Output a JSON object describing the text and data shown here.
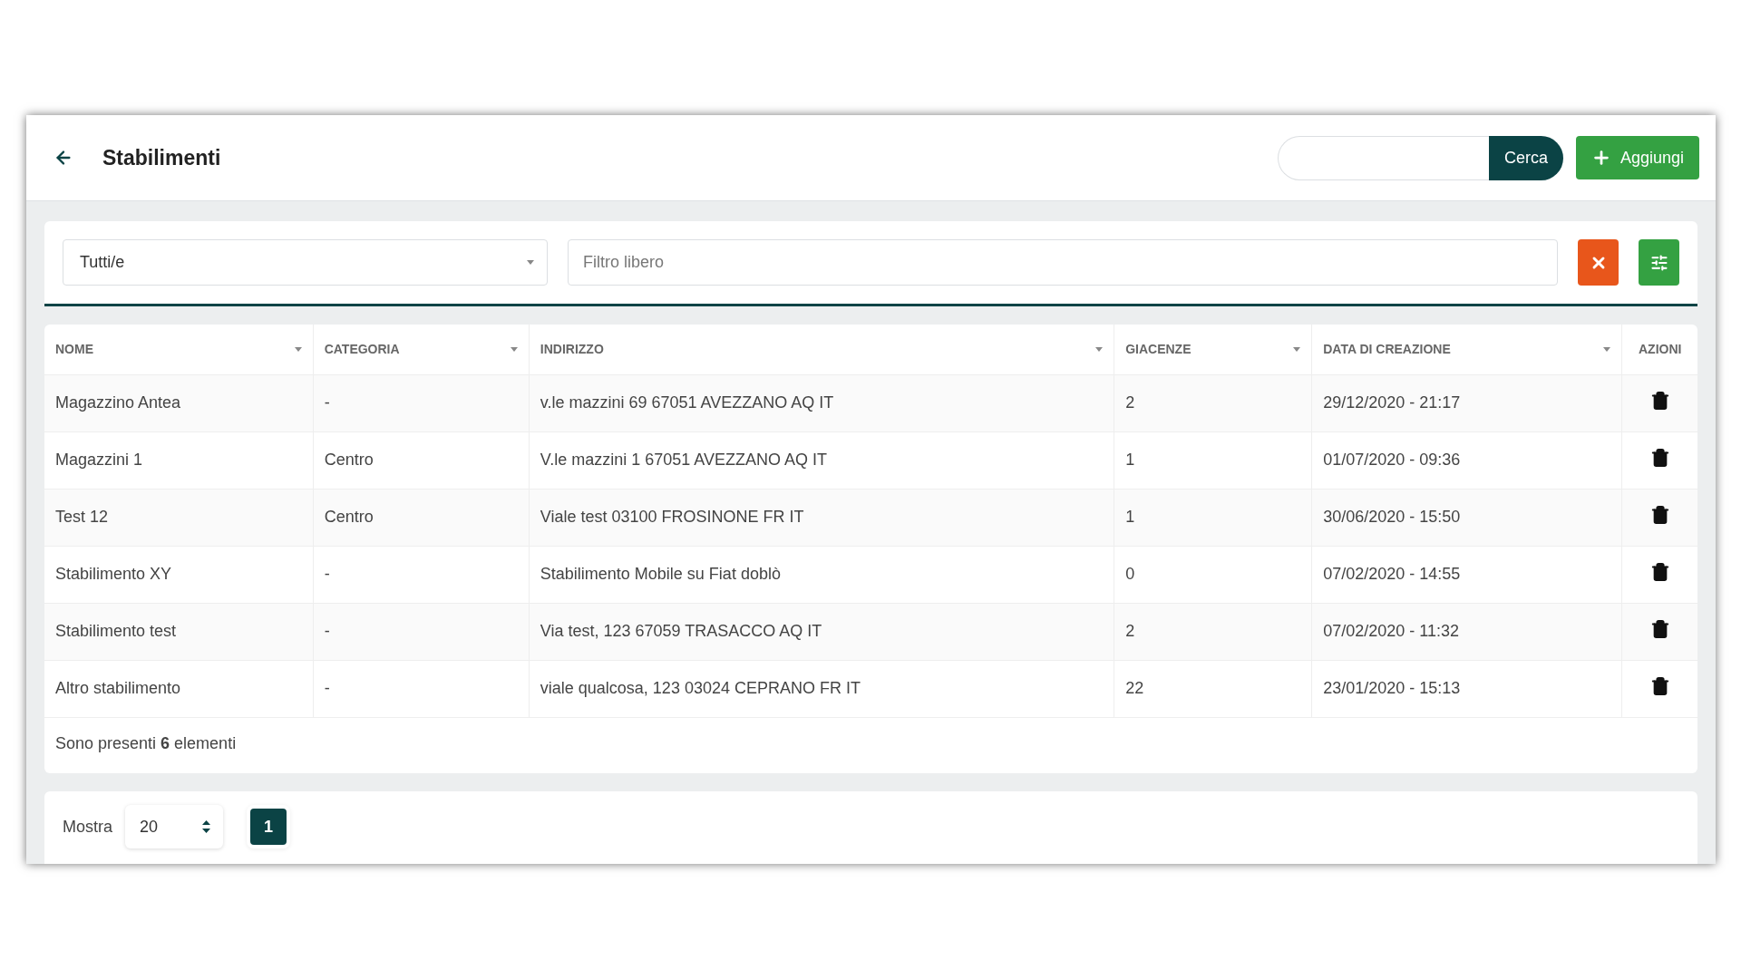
{
  "header": {
    "title": "Stabilimenti",
    "search": {
      "button": "Cerca"
    },
    "add_button": "Aggiungi"
  },
  "filters": {
    "category": "Tutti/e",
    "free_filter": {
      "placeholder": "Filtro libero"
    }
  },
  "table": {
    "columns": [
      {
        "label": "NOME",
        "sortable": true
      },
      {
        "label": "CATEGORIA",
        "sortable": true
      },
      {
        "label": "INDIRIZZO",
        "sortable": true
      },
      {
        "label": "GIACENZE",
        "sortable": true
      },
      {
        "label": "DATA DI CREAZIONE",
        "sortable": true
      },
      {
        "label": "AZIONI",
        "sortable": false
      }
    ],
    "rows": [
      {
        "cells": [
          "Magazzino Antea",
          "-",
          "v.le mazzini 69 67051 AVEZZANO AQ IT",
          "2",
          "29/12/2020 - 21:17"
        ]
      },
      {
        "cells": [
          "Magazzini 1",
          "Centro",
          "V.le mazzini 1 67051 AVEZZANO AQ IT",
          "1",
          "01/07/2020 - 09:36"
        ]
      },
      {
        "cells": [
          "Test 12",
          "Centro",
          "Viale test 03100 FROSINONE FR IT",
          "1",
          "30/06/2020 - 15:50"
        ]
      },
      {
        "cells": [
          "Stabilimento XY",
          "-",
          "Stabilimento Mobile su Fiat doblò",
          "0",
          "07/02/2020 - 14:55"
        ]
      },
      {
        "cells": [
          "Stabilimento test",
          "-",
          "Via test, 123 67059 TRASACCO AQ IT",
          "2",
          "07/02/2020 - 11:32"
        ]
      },
      {
        "cells": [
          "Altro stabilimento",
          "-",
          "viale qualcosa, 123 03024 CEPRANO FR IT",
          "22",
          "23/01/2020 - 15:13"
        ]
      }
    ],
    "summary": "Sono presenti **6** elementi"
  },
  "pagination": {
    "label": "Mostra",
    "page_size": "20",
    "pages": [
      {
        "label": "1",
        "selected": true
      }
    ]
  }
}
